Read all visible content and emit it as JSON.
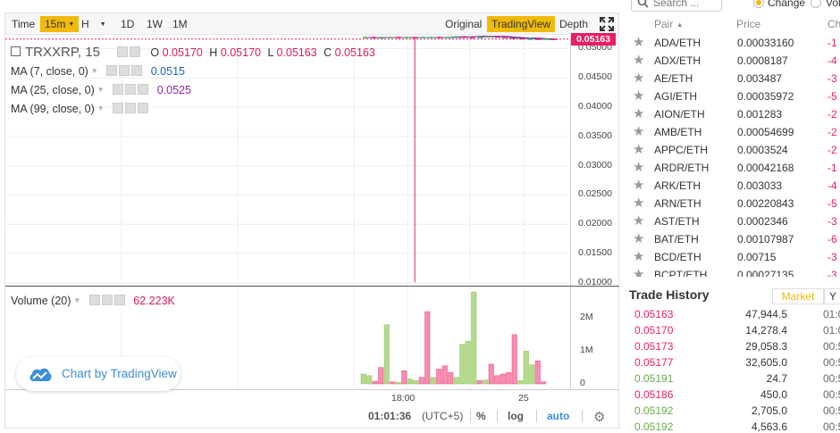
{
  "toolbar": {
    "time_label": "Time",
    "intervals": [
      "15m",
      "H",
      "1D",
      "1W",
      "1M"
    ],
    "active_interval": "15m",
    "views": [
      "Original",
      "TradingView",
      "Depth"
    ],
    "active_view": "TradingView"
  },
  "legend": {
    "title": "TRXXRP, 15",
    "ohlc": [
      {
        "k": "O",
        "v": "0.05170"
      },
      {
        "k": "H",
        "v": "0.05170"
      },
      {
        "k": "L",
        "v": "0.05163"
      },
      {
        "k": "C",
        "v": "0.05163"
      }
    ],
    "ma7_label": "MA (7, close, 0)",
    "ma7_value": "0.0515",
    "ma25_label": "MA (25, close, 0)",
    "ma25_value": "0.0525",
    "ma99_label": "MA (99, close, 0)",
    "volume_label": "Volume (20)",
    "volume_value": "62.223K"
  },
  "price_axis": {
    "last_price": "0.05163",
    "ticks": [
      "0.05000",
      "0.04500",
      "0.04000",
      "0.03500",
      "0.03000",
      "0.02500",
      "0.02000",
      "0.01500",
      "0.01000"
    ]
  },
  "volume_axis": {
    "ticks": [
      "2M",
      "1M",
      "0"
    ]
  },
  "time_axis": {
    "ticks": [
      "18:00",
      "25"
    ]
  },
  "logo_text": "Chart by TradingView",
  "status_bar": {
    "clock": "01:01:36",
    "tz": "(UTC+5)",
    "percent": "%",
    "log": "log",
    "auto": "auto"
  },
  "colors": {
    "accent": "#f0b90b",
    "down": "#e91e63",
    "up": "#6aa84f",
    "vol_up": "#b5d98f",
    "vol_down": "#f48fb1",
    "tv_blue": "#3d8ed8"
  },
  "chart_data": [
    {
      "type": "candlestick",
      "title": "TRXXRP, 15",
      "ylim": [
        0.0095,
        0.0522
      ],
      "note_wick_low": 0.0101,
      "candles": [
        {
          "o": 0.0519,
          "c": 0.052,
          "h": 0.0521,
          "l": 0.0518
        },
        {
          "o": 0.052,
          "c": 0.0518,
          "h": 0.0521,
          "l": 0.0517
        },
        {
          "o": 0.0518,
          "c": 0.0519,
          "h": 0.052,
          "l": 0.0517
        },
        {
          "o": 0.0519,
          "c": 0.052,
          "h": 0.0521,
          "l": 0.0518
        },
        {
          "o": 0.052,
          "c": 0.0519,
          "h": 0.0521,
          "l": 0.0518
        },
        {
          "o": 0.0519,
          "c": 0.052,
          "h": 0.0521,
          "l": 0.0518
        },
        {
          "o": 0.052,
          "c": 0.0519,
          "h": 0.052,
          "l": 0.0101
        },
        {
          "o": 0.0519,
          "c": 0.052,
          "h": 0.0521,
          "l": 0.0518
        },
        {
          "o": 0.052,
          "c": 0.052,
          "h": 0.0521,
          "l": 0.0519
        },
        {
          "o": 0.052,
          "c": 0.0519,
          "h": 0.0521,
          "l": 0.0518
        },
        {
          "o": 0.0519,
          "c": 0.052,
          "h": 0.0521,
          "l": 0.0518
        },
        {
          "o": 0.052,
          "c": 0.0521,
          "h": 0.0522,
          "l": 0.0519
        },
        {
          "o": 0.0521,
          "c": 0.052,
          "h": 0.0522,
          "l": 0.0519
        },
        {
          "o": 0.052,
          "c": 0.0519,
          "h": 0.0521,
          "l": 0.0518
        },
        {
          "o": 0.0519,
          "c": 0.052,
          "h": 0.0521,
          "l": 0.0518
        },
        {
          "o": 0.052,
          "c": 0.0521,
          "h": 0.0522,
          "l": 0.0519
        },
        {
          "o": 0.0521,
          "c": 0.052,
          "h": 0.0522,
          "l": 0.0519
        },
        {
          "o": 0.052,
          "c": 0.0519,
          "h": 0.0521,
          "l": 0.0518
        },
        {
          "o": 0.0519,
          "c": 0.0518,
          "h": 0.052,
          "l": 0.0517
        },
        {
          "o": 0.0518,
          "c": 0.0516,
          "h": 0.0519,
          "l": 0.0515
        },
        {
          "o": 0.0516,
          "c": 0.0517,
          "h": 0.0518,
          "l": 0.0515
        },
        {
          "o": 0.0517,
          "c": 0.0516,
          "h": 0.0518,
          "l": 0.0515
        },
        {
          "o": 0.0516,
          "c": 0.0517,
          "h": 0.0518,
          "l": 0.0515
        },
        {
          "o": 0.0517,
          "c": 0.0516,
          "h": 0.0517,
          "l": 0.0516
        }
      ],
      "ma7": [
        0.0519,
        0.0519,
        0.0519,
        0.0519,
        0.0519,
        0.0519,
        0.0519,
        0.0519,
        0.0519,
        0.0519,
        0.0519,
        0.052,
        0.052,
        0.052,
        0.052,
        0.052,
        0.052,
        0.0519,
        0.0519,
        0.0518,
        0.0517,
        0.0516,
        0.0516,
        0.0515
      ],
      "ma25": [
        0.0519,
        0.0519,
        0.0519,
        0.0519,
        0.0519,
        0.0519,
        0.0519,
        0.0519,
        0.0519,
        0.0519,
        0.0519,
        0.0519,
        0.0519,
        0.052,
        0.0521,
        0.0522,
        0.0522,
        0.0521,
        0.052,
        0.0519,
        0.0518,
        0.0518,
        0.0517,
        0.0516
      ]
    },
    {
      "type": "bar",
      "title": "Volume (20)",
      "ylim": [
        0,
        2800000
      ],
      "bars": [
        {
          "v": 300000,
          "dir": "up"
        },
        {
          "v": 250000,
          "dir": "up"
        },
        {
          "v": 80000,
          "dir": "down"
        },
        {
          "v": 500000,
          "dir": "down"
        },
        {
          "v": 1800000,
          "dir": "up"
        },
        {
          "v": 60000,
          "dir": "down"
        },
        {
          "v": 50000,
          "dir": "up"
        },
        {
          "v": 400000,
          "dir": "down"
        },
        {
          "v": 150000,
          "dir": "up"
        },
        {
          "v": 100000,
          "dir": "up"
        },
        {
          "v": 200000,
          "dir": "down"
        },
        {
          "v": 2200000,
          "dir": "down"
        },
        {
          "v": 200000,
          "dir": "up"
        },
        {
          "v": 450000,
          "dir": "down"
        },
        {
          "v": 550000,
          "dir": "down"
        },
        {
          "v": 350000,
          "dir": "down"
        },
        {
          "v": 200000,
          "dir": "up"
        },
        {
          "v": 1200000,
          "dir": "up"
        },
        {
          "v": 1300000,
          "dir": "up"
        },
        {
          "v": 2800000,
          "dir": "up"
        },
        {
          "v": 100000,
          "dir": "down"
        },
        {
          "v": 120000,
          "dir": "up"
        },
        {
          "v": 600000,
          "dir": "down"
        },
        {
          "v": 250000,
          "dir": "down"
        },
        {
          "v": 300000,
          "dir": "down"
        },
        {
          "v": 350000,
          "dir": "down"
        },
        {
          "v": 1500000,
          "dir": "down"
        },
        {
          "v": 100000,
          "dir": "up"
        },
        {
          "v": 1000000,
          "dir": "up"
        },
        {
          "v": 580000,
          "dir": "up"
        },
        {
          "v": 700000,
          "dir": "down"
        },
        {
          "v": 62223,
          "dir": "down"
        }
      ]
    }
  ],
  "search": {
    "placeholder": "Search ...",
    "options": [
      "Change",
      "Vol"
    ]
  },
  "pairs": {
    "header_pair": "Pair",
    "header_price": "Price",
    "header_change": "Ch",
    "rows": [
      {
        "pair": "ADA/ETH",
        "price": "0.00033160",
        "change": "-1"
      },
      {
        "pair": "ADX/ETH",
        "price": "0.0008187",
        "change": "-4"
      },
      {
        "pair": "AE/ETH",
        "price": "0.003487",
        "change": "-3"
      },
      {
        "pair": "AGI/ETH",
        "price": "0.00035972",
        "change": "-5"
      },
      {
        "pair": "AION/ETH",
        "price": "0.001283",
        "change": "-2"
      },
      {
        "pair": "AMB/ETH",
        "price": "0.00054699",
        "change": "-2"
      },
      {
        "pair": "APPC/ETH",
        "price": "0.0003524",
        "change": "-2"
      },
      {
        "pair": "ARDR/ETH",
        "price": "0.00042168",
        "change": "-1"
      },
      {
        "pair": "ARK/ETH",
        "price": "0.003033",
        "change": "-4"
      },
      {
        "pair": "ARN/ETH",
        "price": "0.00220843",
        "change": "-5"
      },
      {
        "pair": "AST/ETH",
        "price": "0.0002346",
        "change": "-3"
      },
      {
        "pair": "BAT/ETH",
        "price": "0.00107987",
        "change": "-6"
      },
      {
        "pair": "BCD/ETH",
        "price": "0.00715",
        "change": "-3"
      },
      {
        "pair": "BCPT/ETH",
        "price": "0.00027135",
        "change": "-3"
      }
    ]
  },
  "trade_history": {
    "title": "Trade History",
    "tabs": [
      "Market",
      "Y"
    ],
    "rows": [
      {
        "price": "0.05163",
        "amount": "47,944.5",
        "time": "01:0",
        "dir": "down"
      },
      {
        "price": "0.05170",
        "amount": "14,278.4",
        "time": "01:0",
        "dir": "down"
      },
      {
        "price": "0.05173",
        "amount": "29,058.3",
        "time": "00:5",
        "dir": "down"
      },
      {
        "price": "0.05177",
        "amount": "32,605.0",
        "time": "00:5",
        "dir": "down"
      },
      {
        "price": "0.05191",
        "amount": "24.7",
        "time": "00:5",
        "dir": "up"
      },
      {
        "price": "0.05186",
        "amount": "450.0",
        "time": "00:5",
        "dir": "down"
      },
      {
        "price": "0.05192",
        "amount": "2,705.0",
        "time": "00:5",
        "dir": "up"
      },
      {
        "price": "0.05192",
        "amount": "4,563.6",
        "time": "00:5",
        "dir": "up"
      }
    ]
  }
}
